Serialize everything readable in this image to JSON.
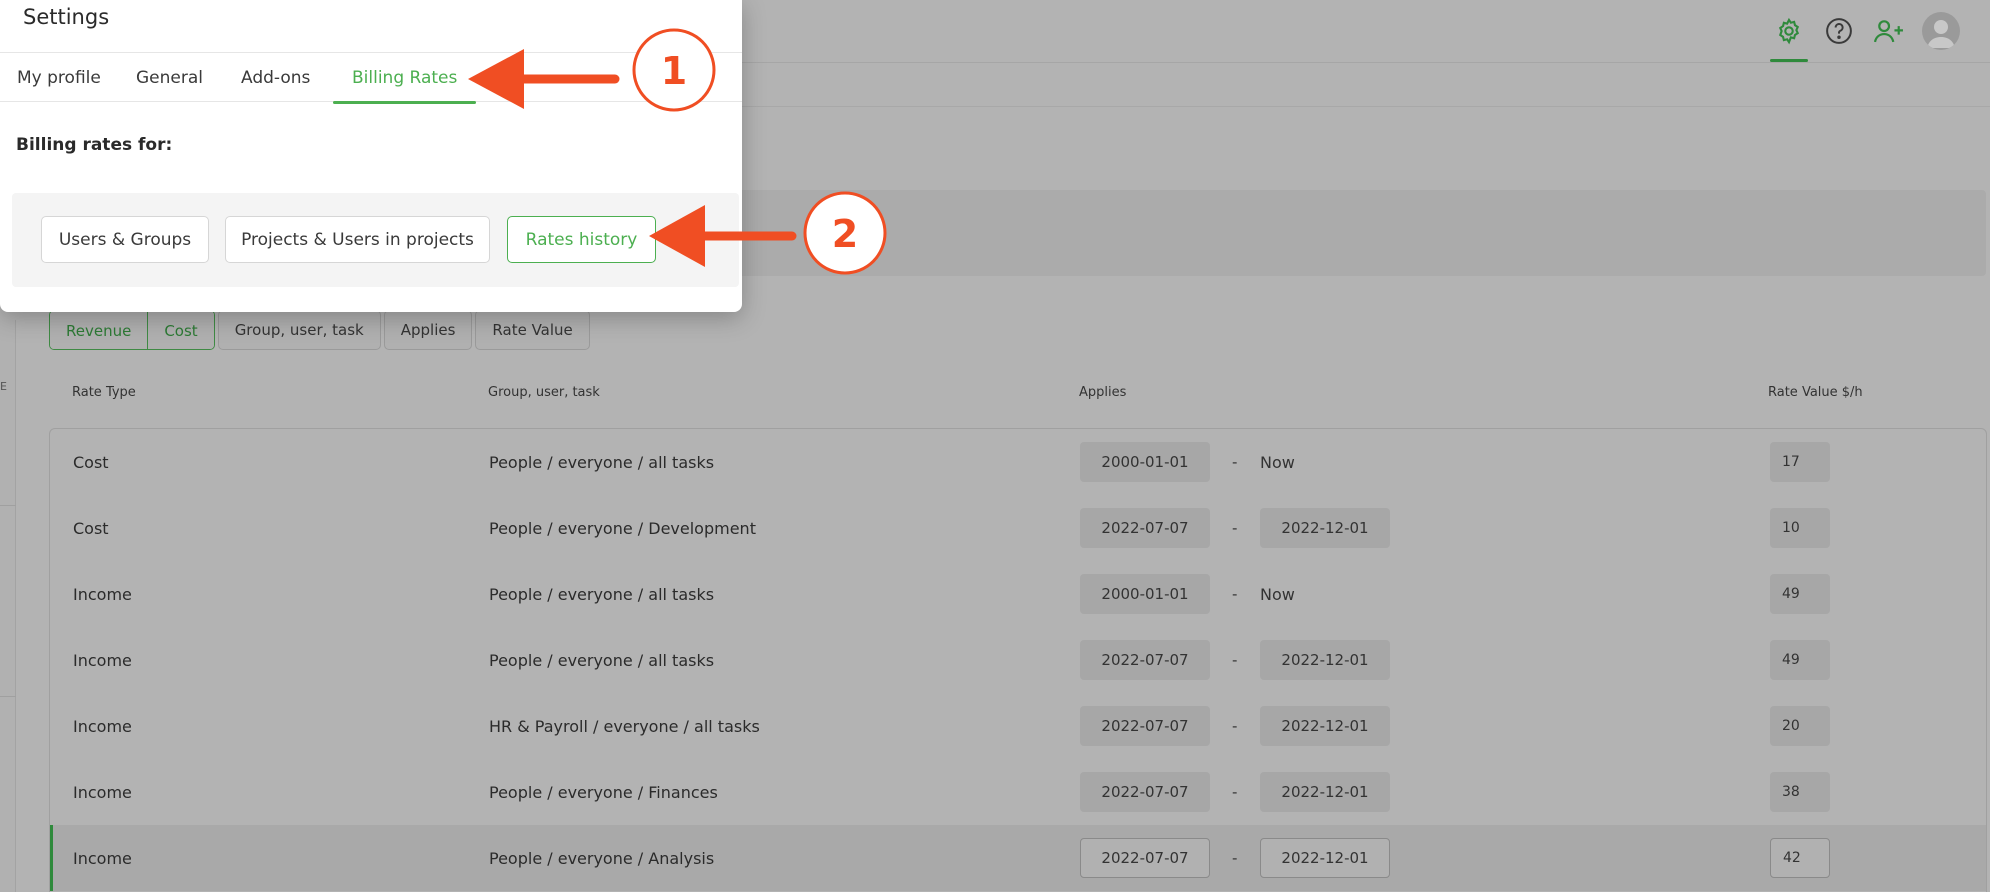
{
  "dialog": {
    "title": "Settings",
    "tabs": [
      "My profile",
      "General",
      "Add-ons",
      "Billing Rates"
    ],
    "active_tab": "Billing Rates",
    "billing_label": "Billing rates for:",
    "choices": [
      "Users & Groups",
      "Projects & Users in projects",
      "Rates history"
    ],
    "active_choice": "Rates history"
  },
  "annotations": {
    "step1": "1",
    "step2": "2",
    "arrow_color": "#f04e23"
  },
  "topbar": {
    "icons": [
      "gear-icon",
      "help-icon",
      "add-user-icon",
      "avatar"
    ]
  },
  "left_rail": {
    "mark": "E"
  },
  "filters": {
    "revenue": "Revenue",
    "cost": "Cost",
    "group_user_task": "Group, user, task",
    "applies": "Applies",
    "rate_value": "Rate Value"
  },
  "columns": {
    "rate_type": "Rate Type",
    "group_user_task": "Group, user, task",
    "applies": "Applies",
    "rate_value": "Rate Value $/h"
  },
  "rows": [
    {
      "type": "Cost",
      "target": "People / everyone / all tasks",
      "from": "2000-01-01",
      "dash": "-",
      "to": "Now",
      "rate": "17"
    },
    {
      "type": "Cost",
      "target": "People / everyone / Development",
      "from": "2022-07-07",
      "dash": "-",
      "to": "2022-12-01",
      "rate": "10"
    },
    {
      "type": "Income",
      "target": "People / everyone / all tasks",
      "from": "2000-01-01",
      "dash": "-",
      "to": "Now",
      "rate": "49"
    },
    {
      "type": "Income",
      "target": "People / everyone / all tasks",
      "from": "2022-07-07",
      "dash": "-",
      "to": "2022-12-01",
      "rate": "49"
    },
    {
      "type": "Income",
      "target": "HR & Payroll / everyone / all tasks",
      "from": "2022-07-07",
      "dash": "-",
      "to": "2022-12-01",
      "rate": "20"
    },
    {
      "type": "Income",
      "target": "People / everyone / Finances",
      "from": "2022-07-07",
      "dash": "-",
      "to": "2022-12-01",
      "rate": "38"
    },
    {
      "type": "Income",
      "target": "People / everyone / Analysis",
      "from": "2022-07-07",
      "dash": "-",
      "to": "2022-12-01",
      "rate": "42"
    }
  ],
  "colors": {
    "accent": "#4caf50",
    "dark_accent": "#2f8a3c",
    "overlay": "#b3b3b3",
    "annotation": "#f04e23"
  }
}
